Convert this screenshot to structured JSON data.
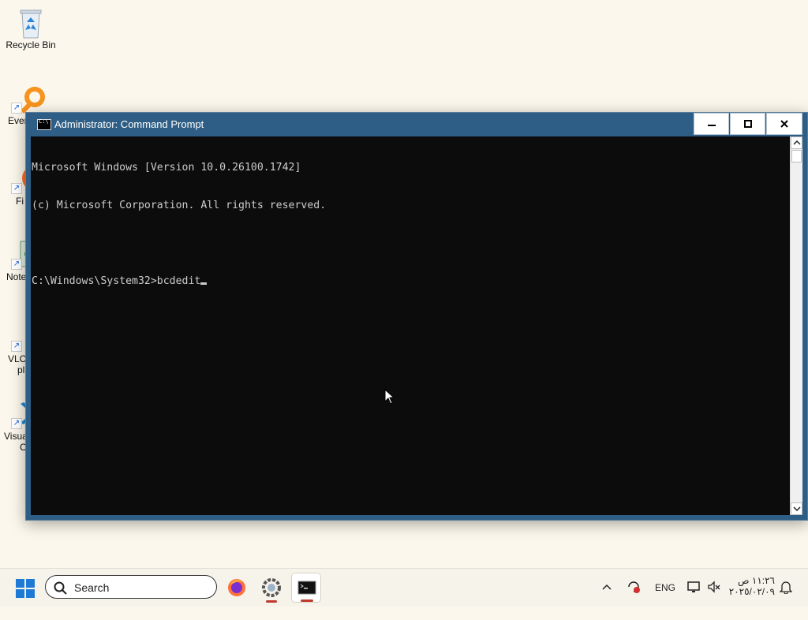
{
  "desktop": {
    "icons": [
      {
        "label": "Recycle Bin"
      },
      {
        "label": "Ever"
      },
      {
        "label": "Fi"
      },
      {
        "label": "Note"
      },
      {
        "label": "VLC"
      },
      {
        "label": "pl"
      },
      {
        "label": "Visua"
      },
      {
        "label": "C"
      }
    ]
  },
  "window": {
    "title": "Administrator: Command Prompt",
    "icon_text": "C:\\",
    "console_lines": [
      "Microsoft Windows [Version 10.0.26100.1742]",
      "(c) Microsoft Corporation. All rights reserved.",
      "",
      "C:\\Windows\\System32>bcdedit"
    ]
  },
  "taskbar": {
    "search_label": "Search",
    "language": "ENG",
    "time": "١١:٢٦ ص",
    "date": "٢٠٢٥/٠٢/٠٩"
  },
  "colors": {
    "desktop_bg": "#fbf7ec",
    "titlebar": "#2e5e85",
    "console_bg": "#0c0c0c",
    "console_fg": "#cccccc"
  }
}
